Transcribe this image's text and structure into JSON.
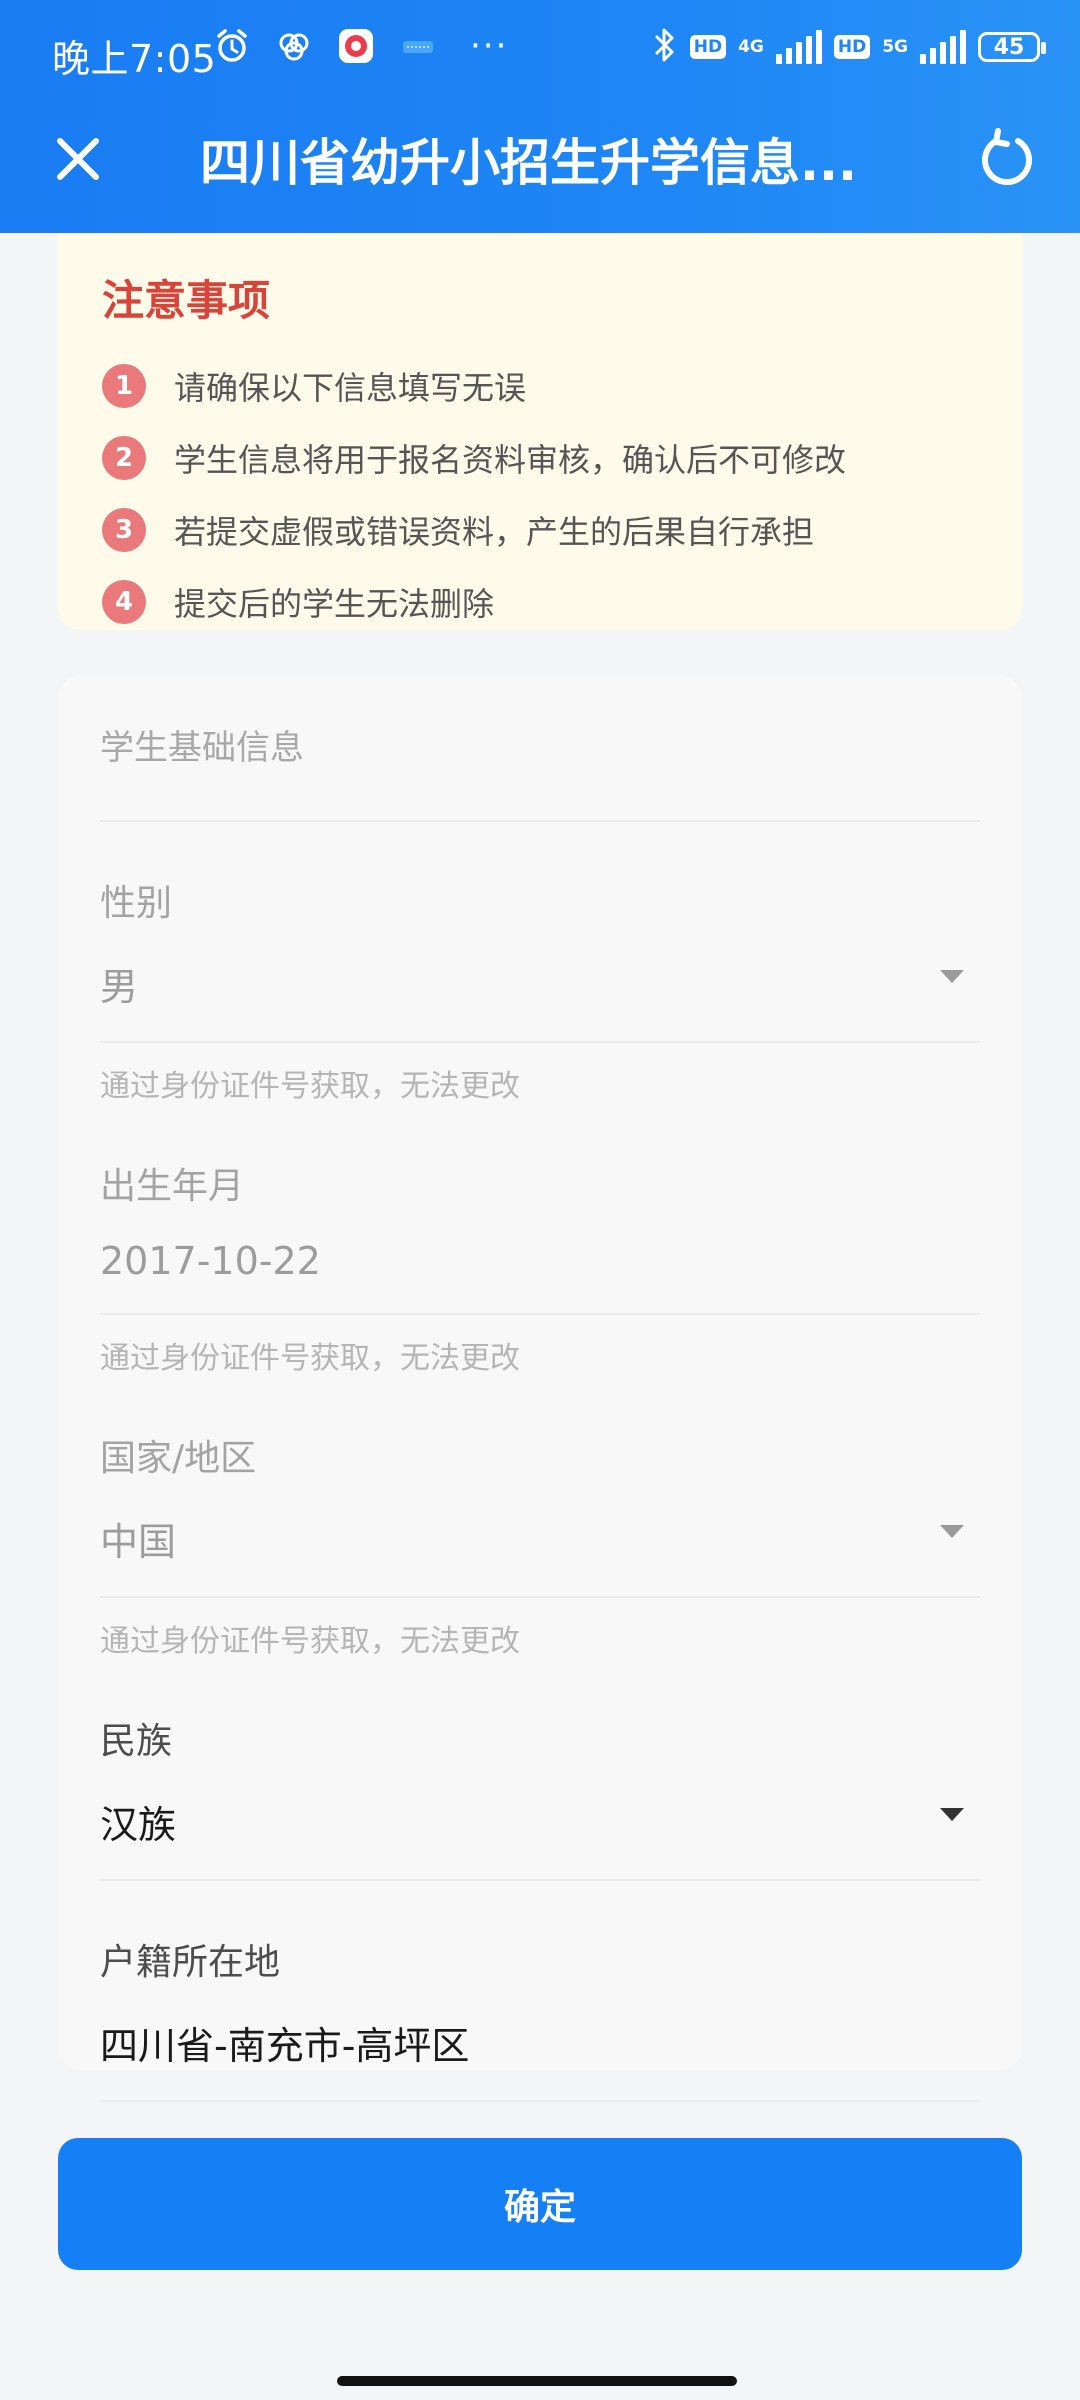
{
  "status_bar": {
    "time": "晚上7:05",
    "dots": "···",
    "hd1": "HD",
    "net1": "4G",
    "hd2": "HD",
    "net2": "5G",
    "battery": "45"
  },
  "nav": {
    "title": "四川省幼升小招生升学信息..."
  },
  "notice": {
    "title": "注意事项",
    "items": [
      {
        "num": "1",
        "text": "请确保以下信息填写无误"
      },
      {
        "num": "2",
        "text": "学生信息将用于报名资料审核，确认后不可修改"
      },
      {
        "num": "3",
        "text": "若提交虚假或错误资料，产生的后果自行承担"
      },
      {
        "num": "4",
        "text": "提交后的学生无法删除"
      }
    ]
  },
  "form": {
    "section_title": "学生基础信息",
    "gender": {
      "label": "性别",
      "value": "男",
      "hint": "通过身份证件号获取，无法更改"
    },
    "birth": {
      "label": "出生年月",
      "value": "2017-10-22",
      "hint": "通过身份证件号获取，无法更改"
    },
    "country": {
      "label": "国家/地区",
      "value": "中国",
      "hint": "通过身份证件号获取，无法更改"
    },
    "ethnicity": {
      "label": "民族",
      "value": "汉族"
    },
    "household": {
      "label": "户籍所在地",
      "value": "四川省-南充市-高坪区"
    }
  },
  "confirm_label": "确定",
  "colors": {
    "primary": "#1580f5",
    "header": "#1e86f5",
    "notice_bg": "#fffbea",
    "notice_title": "#d9443a",
    "badge": "#e9797a"
  }
}
